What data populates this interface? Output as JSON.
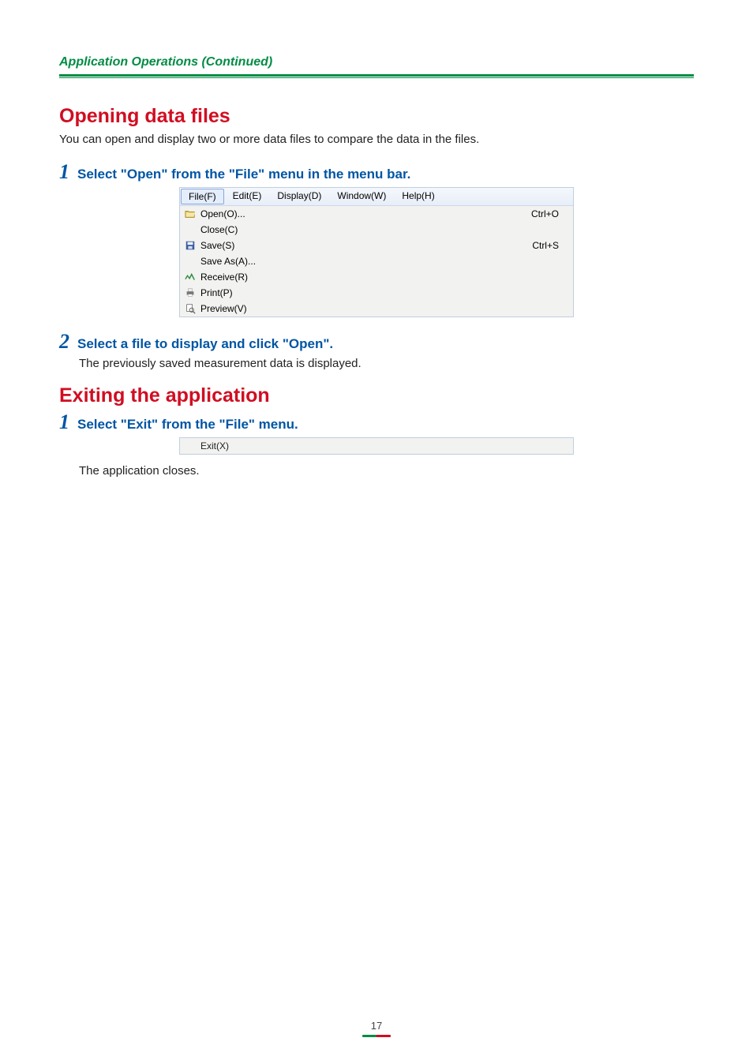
{
  "header": "Application Operations (Continued)",
  "section1": {
    "title": "Opening data files",
    "lead": "You can open and display two or more data files to compare the data in the files.",
    "step1": {
      "num": "1",
      "text": "Select \"Open\" from the \"File\" menu in the menu bar."
    },
    "step2": {
      "num": "2",
      "text": "Select a file to display and click \"Open\".",
      "sub": "The previously saved measurement data is displayed."
    }
  },
  "menu": {
    "bar": [
      "File(F)",
      "Edit(E)",
      "Display(D)",
      "Window(W)",
      "Help(H)"
    ],
    "items": [
      {
        "icon": "open",
        "label": "Open(O)...",
        "shortcut": "Ctrl+O"
      },
      {
        "icon": "",
        "label": "Close(C)",
        "shortcut": ""
      },
      {
        "icon": "save",
        "label": "Save(S)",
        "shortcut": "Ctrl+S"
      },
      {
        "icon": "",
        "label": "Save As(A)...",
        "shortcut": ""
      },
      {
        "icon": "receive",
        "label": "Receive(R)",
        "shortcut": ""
      },
      {
        "icon": "print",
        "label": "Print(P)",
        "shortcut": ""
      },
      {
        "icon": "preview",
        "label": "Preview(V)",
        "shortcut": ""
      }
    ]
  },
  "section2": {
    "title": "Exiting the application",
    "step1": {
      "num": "1",
      "text": "Select \"Exit\" from the \"File\" menu."
    },
    "exit_item": "Exit(X)",
    "closes": "The application closes."
  },
  "page_number": "17"
}
